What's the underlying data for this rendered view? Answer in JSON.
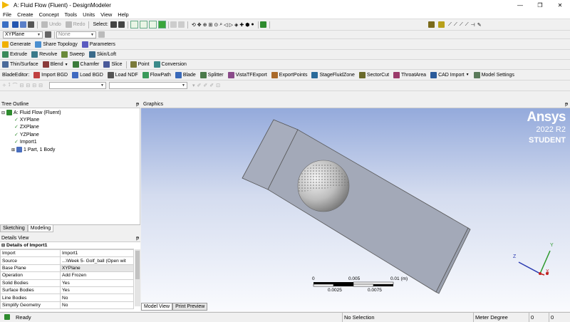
{
  "window": {
    "title": "A: Fluid Flow (Fluent) - DesignModeler",
    "minimize": "—",
    "restore": "❐",
    "close": "✕"
  },
  "menu": [
    "File",
    "Create",
    "Concept",
    "Tools",
    "Units",
    "View",
    "Help"
  ],
  "toolbar1": {
    "undo": "Undo",
    "redo": "Redo",
    "select_label": "Select:"
  },
  "toolbar2": {
    "plane_value": "XYPlane",
    "sketch_value": "None"
  },
  "toolbar3": {
    "generate": "Generate",
    "share_topology": "Share Topology",
    "parameters": "Parameters"
  },
  "toolbar4": {
    "extrude": "Extrude",
    "revolve": "Revolve",
    "sweep": "Sweep",
    "skin_loft": "Skin/Loft"
  },
  "toolbar5": {
    "thin_surface": "Thin/Surface",
    "blend": "Blend",
    "chamfer": "Chamfer",
    "slice": "Slice",
    "point": "Point",
    "conversion": "Conversion"
  },
  "toolbar6": {
    "label": "BladeEditor:",
    "import_bgd": "Import BGD",
    "load_bgd": "Load BGD",
    "load_ndf": "Load NDF",
    "flowpath": "FlowPath",
    "blade": "Blade",
    "splitter": "Splitter",
    "vistatf_export": "VistaTFExport",
    "export_points": "ExportPoints",
    "stage_fluid_zone": "StageFluidZone",
    "sector_cut": "SectorCut",
    "throat_area": "ThroatArea",
    "cad_import": "CAD Import",
    "model_settings": "Model Settings"
  },
  "tree": {
    "header": "Tree Outline",
    "pin": "ᵽ",
    "items": [
      "A: Fluid Flow (Fluent)",
      "XYPlane",
      "ZXPlane",
      "YZPlane",
      "Import1",
      "1 Part, 1 Body"
    ]
  },
  "left_tabs": [
    "Sketching",
    "Modeling"
  ],
  "details": {
    "header": "Details View",
    "section": "Details of Import1",
    "rows": [
      {
        "k": "Import",
        "v": "Import1"
      },
      {
        "k": "Source",
        "v": "...\\Week 5- Golf_ball (Open wit"
      },
      {
        "k": "Base Plane",
        "v": "XYPlane"
      },
      {
        "k": "Operation",
        "v": "Add Frozen"
      },
      {
        "k": "Solid Bodies",
        "v": "Yes"
      },
      {
        "k": "Surface Bodies",
        "v": "Yes"
      },
      {
        "k": "Line Bodies",
        "v": "No"
      },
      {
        "k": "Simplify Geometry",
        "v": "No"
      }
    ]
  },
  "graphics": {
    "header": "Graphics",
    "brand": "Ansys",
    "version": "2022 R2",
    "edition": "STUDENT",
    "scale_top": [
      "0",
      "0.005",
      "0.01 (m)"
    ],
    "scale_bottom": [
      "0.0025",
      "0.0075"
    ],
    "axis": {
      "x": "X",
      "y": "Y",
      "z": "Z"
    },
    "tabs": [
      "Model View",
      "Print Preview"
    ]
  },
  "status": {
    "ready": "Ready",
    "selection": "No Selection",
    "units": "Meter  Degree",
    "a": "0",
    "b": "0"
  },
  "colors": {
    "accent_green": "#2e8b2e",
    "graphics_top": "#8fa6da",
    "body_fill": "#a4aab9"
  }
}
